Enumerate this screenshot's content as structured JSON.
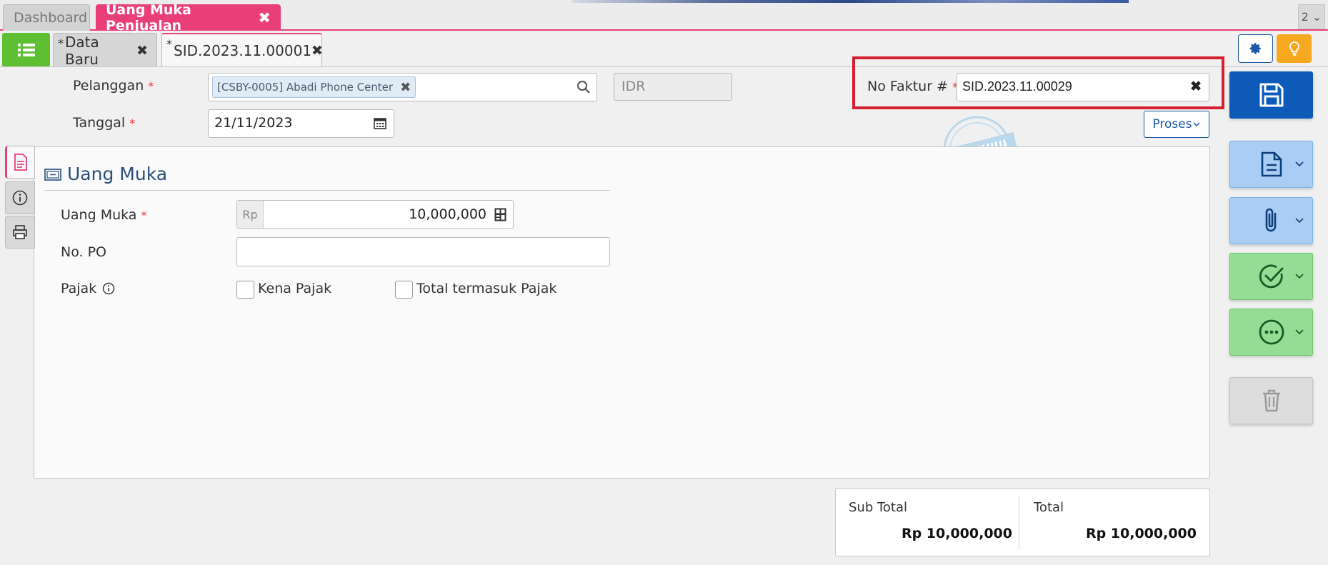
{
  "top_tabs": {
    "dashboard": "Dashboard",
    "active": "Uang Muka Penjualan",
    "close": "✖",
    "pager": "2 ⌄"
  },
  "sub_tabs": [
    {
      "marker": "*",
      "label": "Data Baru",
      "close": "✖"
    },
    {
      "marker": "*",
      "label": "SID.2023.11.00001",
      "close": "✖"
    }
  ],
  "header": {
    "customer_label": "Pelanggan",
    "customer_chip": "[CSBY-0005] Abadi Phone Center",
    "chip_remove": "✖",
    "currency": "IDR",
    "date_label": "Tanggal",
    "date_value": "21/11/2023",
    "invoice_label": "No Faktur #",
    "invoice_value": "SID.2023.11.00029",
    "invoice_clear": "✖",
    "process_button": "Proses",
    "required_mark": "*"
  },
  "stamp_text": "DISETUJUI",
  "section": {
    "title": "Uang Muka",
    "down_payment_label": "Uang Muka",
    "currency_prefix": "Rp",
    "down_payment_value": "10,000,000",
    "po_label": "No. PO",
    "po_value": "",
    "tax_label": "Pajak",
    "taxable_label": "Kena Pajak",
    "taxable_checked": false,
    "tax_included_label": "Total termasuk Pajak",
    "tax_included_checked": false
  },
  "totals": {
    "subtotal_label": "Sub Total",
    "subtotal_value": "Rp 10,000,000",
    "total_label": "Total",
    "total_value": "Rp 10,000,000"
  },
  "icons": {
    "list": "list-icon",
    "settings": "gear-icon",
    "tips": "lightbulb-icon",
    "save": "save-icon",
    "document": "document-icon",
    "attachment": "paperclip-icon",
    "approve": "check-circle-icon",
    "more": "more-circle-icon",
    "delete": "trash-icon"
  },
  "colors": {
    "accent_pink": "#e93f78",
    "primary_blue": "#0d5ab8",
    "list_green": "#5fbf33",
    "tips_orange": "#f6a821",
    "highlight_red": "#d3212f"
  }
}
